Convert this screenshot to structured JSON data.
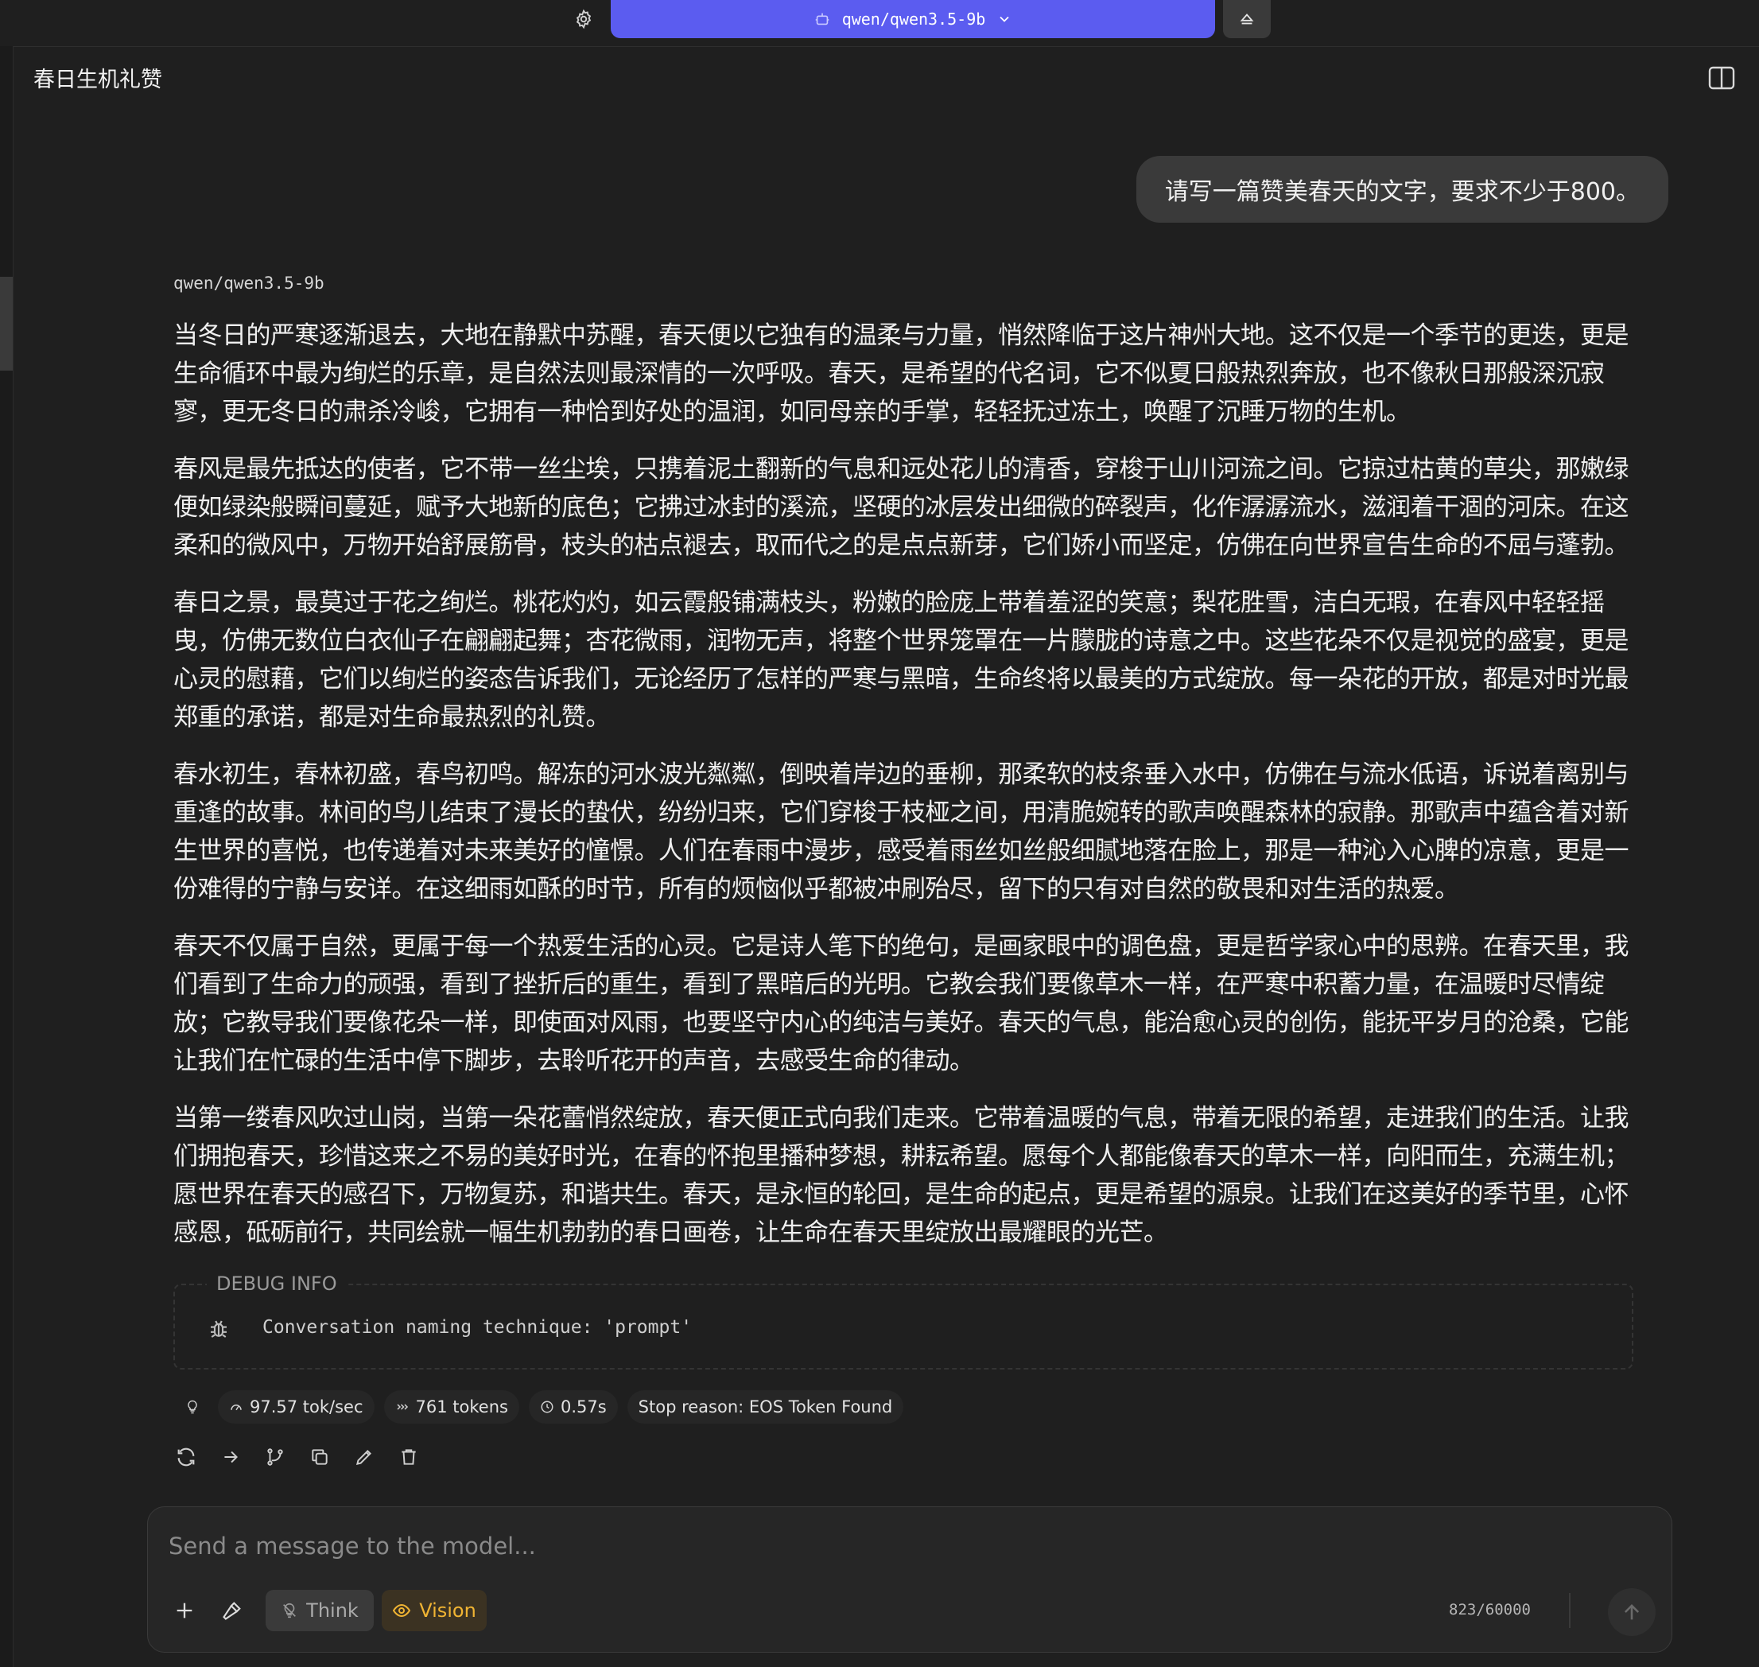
{
  "topbar": {
    "model_name": "qwen/qwen3.5-9b"
  },
  "conversation": {
    "title": "春日生机礼赞"
  },
  "user_message": "请写一篇赞美春天的文字，要求不少于800。",
  "assistant": {
    "model_label": "qwen/qwen3.5-9b",
    "paragraphs": [
      "当冬日的严寒逐渐退去，大地在静默中苏醒，春天便以它独有的温柔与力量，悄然降临于这片神州大地。这不仅是一个季节的更迭，更是生命循环中最为绚烂的乐章，是自然法则最深情的一次呼吸。春天，是希望的代名词，它不似夏日般热烈奔放，也不像秋日那般深沉寂寥，更无冬日的肃杀冷峻，它拥有一种恰到好处的温润，如同母亲的手掌，轻轻抚过冻土，唤醒了沉睡万物的生机。",
      "春风是最先抵达的使者，它不带一丝尘埃，只携着泥土翻新的气息和远处花儿的清香，穿梭于山川河流之间。它掠过枯黄的草尖，那嫩绿便如绿染般瞬间蔓延，赋予大地新的底色；它拂过冰封的溪流，坚硬的冰层发出细微的碎裂声，化作潺潺流水，滋润着干涸的河床。在这柔和的微风中，万物开始舒展筋骨，枝头的枯点褪去，取而代之的是点点新芽，它们娇小而坚定，仿佛在向世界宣告生命的不屈与蓬勃。",
      "春日之景，最莫过于花之绚烂。桃花灼灼，如云霞般铺满枝头，粉嫩的脸庞上带着羞涩的笑意；梨花胜雪，洁白无瑕，在春风中轻轻摇曳，仿佛无数位白衣仙子在翩翩起舞；杏花微雨，润物无声，将整个世界笼罩在一片朦胧的诗意之中。这些花朵不仅是视觉的盛宴，更是心灵的慰藉，它们以绚烂的姿态告诉我们，无论经历了怎样的严寒与黑暗，生命终将以最美的方式绽放。每一朵花的开放，都是对时光最郑重的承诺，都是对生命最热烈的礼赞。",
      "春水初生，春林初盛，春鸟初鸣。解冻的河水波光粼粼，倒映着岸边的垂柳，那柔软的枝条垂入水中，仿佛在与流水低语，诉说着离别与重逢的故事。林间的鸟儿结束了漫长的蛰伏，纷纷归来，它们穿梭于枝桠之间，用清脆婉转的歌声唤醒森林的寂静。那歌声中蕴含着对新生世界的喜悦，也传递着对未来美好的憧憬。人们在春雨中漫步，感受着雨丝如丝般细腻地落在脸上，那是一种沁入心脾的凉意，更是一份难得的宁静与安详。在这细雨如酥的时节，所有的烦恼似乎都被冲刷殆尽，留下的只有对自然的敬畏和对生活的热爱。",
      "春天不仅属于自然，更属于每一个热爱生活的心灵。它是诗人笔下的绝句，是画家眼中的调色盘，更是哲学家心中的思辨。在春天里，我们看到了生命力的顽强，看到了挫折后的重生，看到了黑暗后的光明。它教会我们要像草木一样，在严寒中积蓄力量，在温暖时尽情绽放；它教导我们要像花朵一样，即使面对风雨，也要坚守内心的纯洁与美好。春天的气息，能治愈心灵的创伤，能抚平岁月的沧桑，它能让我们在忙碌的生活中停下脚步，去聆听花开的声音，去感受生命的律动。",
      "当第一缕春风吹过山岗，当第一朵花蕾悄然绽放，春天便正式向我们走来。它带着温暖的气息，带着无限的希望，走进我们的生活。让我们拥抱春天，珍惜这来之不易的美好时光，在春的怀抱里播种梦想，耕耘希望。愿每个人都能像春天的草木一样，向阳而生，充满生机；愿世界在春天的感召下，万物复苏，和谐共生。春天，是永恒的轮回，是生命的起点，更是希望的源泉。让我们在这美好的季节里，心怀感恩，砥砺前行，共同绘就一幅生机勃勃的春日画卷，让生命在春天里绽放出最耀眼的光芒。"
    ]
  },
  "debug": {
    "legend": "DEBUG INFO",
    "text": "Conversation naming technique: 'prompt'"
  },
  "stats": {
    "speed": "97.57 tok/sec",
    "tokens": "761 tokens",
    "time": "0.57s",
    "stop_reason": "Stop reason: EOS Token Found"
  },
  "composer": {
    "placeholder": "Send a message to the model...",
    "think_label": "Think",
    "vision_label": "Vision",
    "token_count": "823/60000"
  },
  "colors": {
    "accent": "#5b5cf0",
    "vision": "#f0b433",
    "background": "#1f1f1f"
  }
}
